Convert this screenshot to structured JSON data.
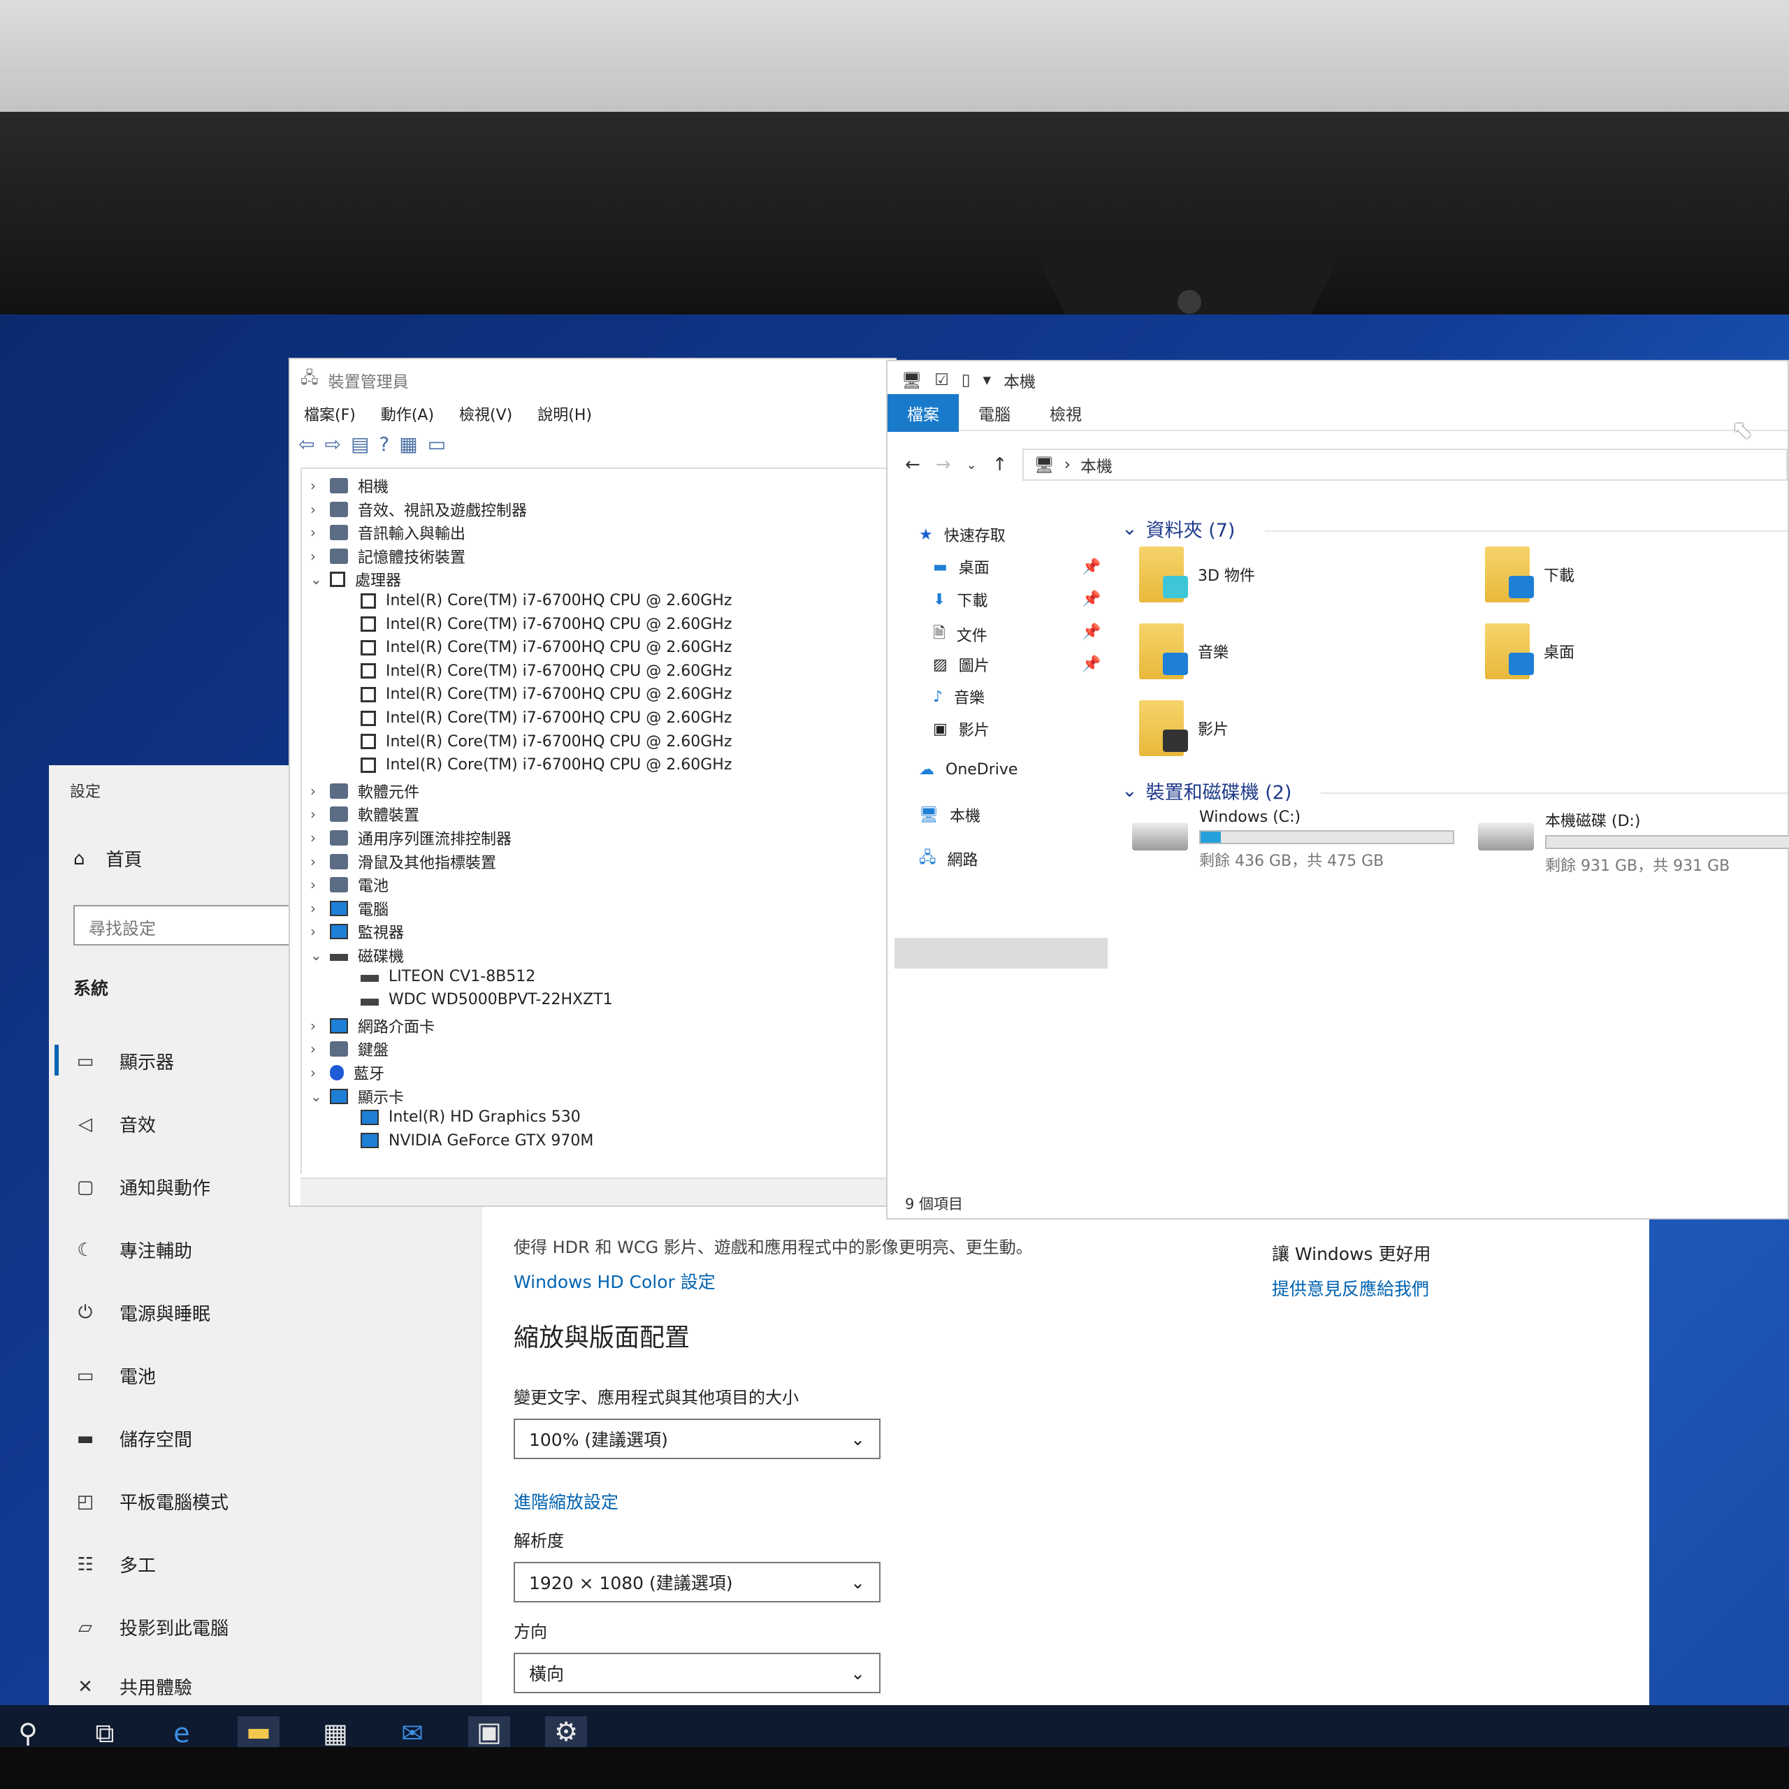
{
  "settings": {
    "title": "設定",
    "home": "首頁",
    "search_placeholder": "尋找設定",
    "section": "系統",
    "nav": [
      {
        "label": "顯示器",
        "icon": "monitor-icon"
      },
      {
        "label": "音效",
        "icon": "speaker-icon"
      },
      {
        "label": "通知與動作",
        "icon": "chat-icon"
      },
      {
        "label": "專注輔助",
        "icon": "moon-icon"
      },
      {
        "label": "電源與睡眠",
        "icon": "power-icon"
      },
      {
        "label": "電池",
        "icon": "battery-icon"
      },
      {
        "label": "儲存空間",
        "icon": "storage-icon"
      },
      {
        "label": "平板電腦模式",
        "icon": "tablet-icon"
      },
      {
        "label": "多工",
        "icon": "multitask-icon"
      },
      {
        "label": "投影到此電腦",
        "icon": "project-icon"
      },
      {
        "label": "共用體驗",
        "icon": "share-icon"
      }
    ],
    "hdr_desc": "使得 HDR 和 WCG 影片、遊戲和應用程式中的影像更明亮、更生動。",
    "hdr_link": "Windows HD Color 設定",
    "zoom_heading": "縮放與版面配置",
    "zoom_label": "變更文字、應用程式與其他項目的大小",
    "zoom_value": "100% (建議選項)",
    "advanced_link": "進階縮放設定",
    "resolution_label": "解析度",
    "resolution_value": "1920 × 1080 (建議選項)",
    "orientation_label": "方向",
    "orientation_value": "橫向",
    "feedback_title": "讓 Windows 更好用",
    "feedback_link": "提供意見反應給我們"
  },
  "device_manager": {
    "title": "裝置管理員",
    "menu": [
      "檔案(F)",
      "動作(A)",
      "檢視(V)",
      "說明(H)"
    ],
    "tree": [
      {
        "label": "相機",
        "level": 0,
        "expand": "›",
        "icon": "gen"
      },
      {
        "label": "音效、視訊及遊戲控制器",
        "level": 0,
        "expand": "›",
        "icon": "gen"
      },
      {
        "label": "音訊輸入與輸出",
        "level": 0,
        "expand": "›",
        "icon": "gen"
      },
      {
        "label": "記憶體技術裝置",
        "level": 0,
        "expand": "›",
        "icon": "gen"
      },
      {
        "label": "處理器",
        "level": 0,
        "expand": "⌄",
        "icon": "cpu"
      },
      {
        "label": "Intel(R) Core(TM) i7-6700HQ CPU @ 2.60GHz",
        "level": 1,
        "icon": "cpu"
      },
      {
        "label": "Intel(R) Core(TM) i7-6700HQ CPU @ 2.60GHz",
        "level": 1,
        "icon": "cpu"
      },
      {
        "label": "Intel(R) Core(TM) i7-6700HQ CPU @ 2.60GHz",
        "level": 1,
        "icon": "cpu"
      },
      {
        "label": "Intel(R) Core(TM) i7-6700HQ CPU @ 2.60GHz",
        "level": 1,
        "icon": "cpu"
      },
      {
        "label": "Intel(R) Core(TM) i7-6700HQ CPU @ 2.60GHz",
        "level": 1,
        "icon": "cpu"
      },
      {
        "label": "Intel(R) Core(TM) i7-6700HQ CPU @ 2.60GHz",
        "level": 1,
        "icon": "cpu"
      },
      {
        "label": "Intel(R) Core(TM) i7-6700HQ CPU @ 2.60GHz",
        "level": 1,
        "icon": "cpu"
      },
      {
        "label": "Intel(R) Core(TM) i7-6700HQ CPU @ 2.60GHz",
        "level": 1,
        "icon": "cpu"
      },
      {
        "label": "軟體元件",
        "level": 0,
        "expand": "›",
        "icon": "gen"
      },
      {
        "label": "軟體裝置",
        "level": 0,
        "expand": "›",
        "icon": "gen"
      },
      {
        "label": "通用序列匯流排控制器",
        "level": 0,
        "expand": "›",
        "icon": "gen"
      },
      {
        "label": "滑鼠及其他指標裝置",
        "level": 0,
        "expand": "›",
        "icon": "gen"
      },
      {
        "label": "電池",
        "level": 0,
        "expand": "›",
        "icon": "gen"
      },
      {
        "label": "電腦",
        "level": 0,
        "expand": "›",
        "icon": "mon"
      },
      {
        "label": "監視器",
        "level": 0,
        "expand": "›",
        "icon": "mon"
      },
      {
        "label": "磁碟機",
        "level": 0,
        "expand": "⌄",
        "icon": "disk"
      },
      {
        "label": "LITEON CV1-8B512",
        "level": 1,
        "icon": "disk"
      },
      {
        "label": "WDC WD5000BPVT-22HXZT1",
        "level": 1,
        "icon": "disk"
      },
      {
        "label": "網路介面卡",
        "level": 0,
        "expand": "›",
        "icon": "mon"
      },
      {
        "label": "鍵盤",
        "level": 0,
        "expand": "›",
        "icon": "gen"
      },
      {
        "label": "藍牙",
        "level": 0,
        "expand": "›",
        "icon": "bt"
      },
      {
        "label": "顯示卡",
        "level": 0,
        "expand": "⌄",
        "icon": "mon"
      },
      {
        "label": "Intel(R) HD Graphics 530",
        "level": 1,
        "icon": "mon"
      },
      {
        "label": "NVIDIA GeForce GTX 970M",
        "level": 1,
        "icon": "mon"
      }
    ]
  },
  "explorer": {
    "title": "本機",
    "tabs": [
      "檔案",
      "電腦",
      "檢視"
    ],
    "path": "本機",
    "nav": [
      {
        "label": "快速存取",
        "icon": "star-icon",
        "pinned": false
      },
      {
        "label": "桌面",
        "icon": "desktop-icon",
        "pinned": true
      },
      {
        "label": "下載",
        "icon": "download-icon",
        "pinned": true
      },
      {
        "label": "文件",
        "icon": "document-icon",
        "pinned": true
      },
      {
        "label": "圖片",
        "icon": "picture-icon",
        "pinned": true
      },
      {
        "label": "音樂",
        "icon": "music-icon",
        "pinned": false
      },
      {
        "label": "影片",
        "icon": "video-icon",
        "pinned": false
      },
      {
        "label": "OneDrive",
        "icon": "cloud-icon",
        "pinned": false
      },
      {
        "label": "本機",
        "icon": "computer-icon",
        "pinned": false
      },
      {
        "label": "網路",
        "icon": "network-icon",
        "pinned": false
      }
    ],
    "folders_heading": "資料夾 (7)",
    "folders": [
      "3D 物件",
      "下載",
      "音樂",
      "桌面",
      "影片"
    ],
    "drives_heading": "裝置和磁碟機 (2)",
    "drives": [
      {
        "name": "Windows (C:)",
        "free": "剩餘 436 GB，共 475 GB",
        "used_fraction": 0.08
      },
      {
        "name": "本機磁碟 (D:)",
        "free": "剩餘 931 GB，共 931 GB",
        "used_fraction": 0.0
      }
    ],
    "status": "9 個項目"
  },
  "taskbar": [
    "search-icon",
    "task-view-icon",
    "edge-icon",
    "file-explorer-icon",
    "store-icon",
    "mail-icon",
    "device-manager-icon",
    "settings-icon"
  ]
}
